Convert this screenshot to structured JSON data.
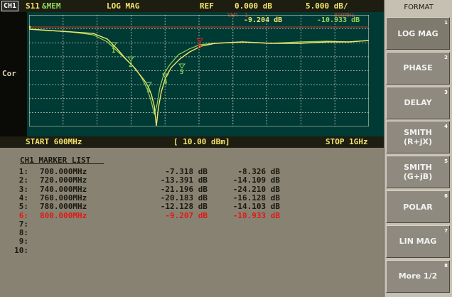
{
  "header": {
    "channel": "CH1",
    "param": "S11",
    "mem": "&MEM",
    "format": "LOG MAG",
    "ref_label": "REF",
    "ref_value": "0.000 dB",
    "scale": "5.000 dB/"
  },
  "overlay": {
    "marker_value_1": "-9.204 dB",
    "marker_value_2": "-10.933 dB",
    "overlay_label_left": "VWR  1",
    "overlay_label_right": "800MHz"
  },
  "side": {
    "cor": "Cor"
  },
  "footer": {
    "start": "START 600MHz",
    "power": "[ 10.00 dBm]",
    "stop": "STOP 1GHz"
  },
  "marker_list": {
    "title": "CH1 MARKER LIST",
    "rows": [
      {
        "index": "1:",
        "freq": "700.000MHz",
        "v1": "-7.318 dB",
        "v2": "-8.326 dB"
      },
      {
        "index": "2:",
        "freq": "720.000MHz",
        "v1": "-13.391 dB",
        "v2": "-14.109 dB"
      },
      {
        "index": "3:",
        "freq": "740.000MHz",
        "v1": "-21.196 dB",
        "v2": "-24.210 dB"
      },
      {
        "index": "4:",
        "freq": "760.000MHz",
        "v1": "-20.183 dB",
        "v2": "-16.128 dB"
      },
      {
        "index": "5:",
        "freq": "780.000MHz",
        "v1": "-12.128 dB",
        "v2": "-14.103 dB"
      },
      {
        "index": "6:",
        "freq": "800.000MHz",
        "v1": "-9.207 dB",
        "v2": "-10.933 dB"
      },
      {
        "index": "7:",
        "freq": "",
        "v1": "",
        "v2": ""
      },
      {
        "index": "8:",
        "freq": "",
        "v1": "",
        "v2": ""
      },
      {
        "index": "9:",
        "freq": "",
        "v1": "",
        "v2": ""
      },
      {
        "index": "10:",
        "freq": "",
        "v1": "",
        "v2": ""
      }
    ],
    "active_index": 5,
    "active_color": "#e01a14"
  },
  "softkeys": {
    "title": "FORMAT",
    "keys": [
      {
        "line1": "LOG MAG",
        "line2": "",
        "num": "1"
      },
      {
        "line1": "PHASE",
        "line2": "",
        "num": "2"
      },
      {
        "line1": "DELAY",
        "line2": "",
        "num": "3"
      },
      {
        "line1": "SMITH",
        "line2": "(R+jX)",
        "num": "4"
      },
      {
        "line1": "SMITH",
        "line2": "(G+jB)",
        "num": "5"
      },
      {
        "line1": "POLAR",
        "line2": "",
        "num": "6"
      },
      {
        "line1": "LIN MAG",
        "line2": "",
        "num": "7"
      },
      {
        "line1": "More 1/2",
        "line2": "",
        "num": "8"
      }
    ]
  },
  "trace_markers": [
    "1",
    "2",
    "3",
    "4",
    "5",
    "6"
  ],
  "colors": {
    "trace_data": "#f4e56a",
    "trace_memory": "#93d35a",
    "grid": "#c9cfc0",
    "ref_line": "#c93a2a"
  }
}
